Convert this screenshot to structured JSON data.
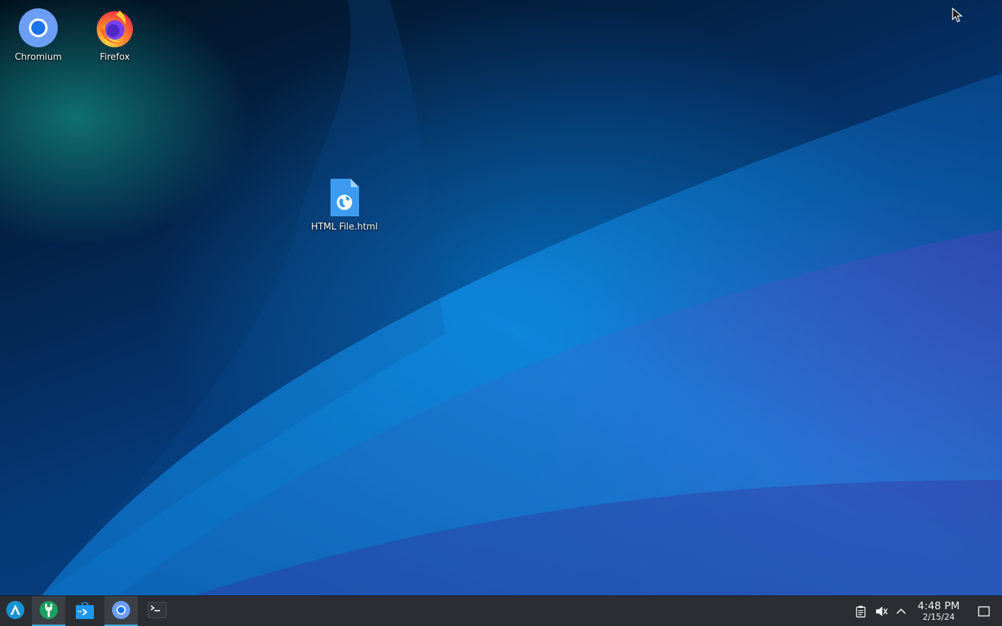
{
  "desktop": {
    "icons": [
      {
        "label": "Chromium",
        "icon": "chromium-icon"
      },
      {
        "label": "Firefox",
        "icon": "firefox-icon"
      },
      {
        "label": "HTML File.html",
        "icon": "html-file-icon"
      }
    ]
  },
  "taskbar": {
    "launcher_icon": "app-launcher-icon",
    "apps": [
      {
        "name": "system-settings",
        "icon": "wrench-icon"
      },
      {
        "name": "discover",
        "icon": "store-icon"
      },
      {
        "name": "chromium",
        "icon": "chromium-icon"
      },
      {
        "name": "terminal",
        "icon": "terminal-icon"
      }
    ],
    "tray": {
      "clipboard_icon": "clipboard-icon",
      "volume_icon": "volume-muted-icon",
      "expand_icon": "chevron-up-icon",
      "time": "4:48 PM",
      "date": "2/15/24",
      "show_desktop_icon": "show-desktop-icon"
    }
  },
  "colors": {
    "taskbar_bg": "#2a2e32",
    "accent": "#3daee9",
    "text": "#eff0f1"
  }
}
